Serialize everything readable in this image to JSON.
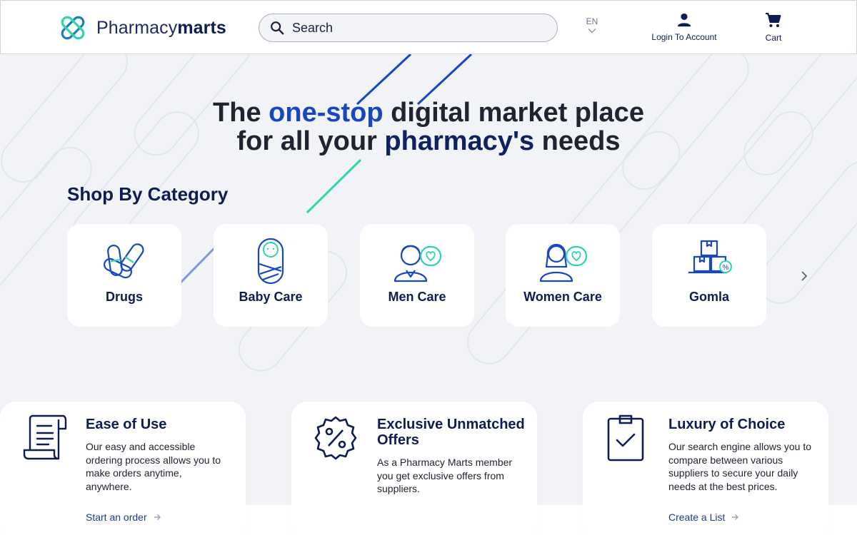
{
  "header": {
    "logo_text_light": "Pharmacy",
    "logo_text_bold": "marts",
    "search_placeholder": "Search",
    "language": "EN",
    "login_label": "Login To Account",
    "cart_label": "Cart"
  },
  "hero": {
    "line1_a": "The ",
    "line1_hl": "one-stop",
    "line1_b": " digital market place",
    "line2_a": "for all your ",
    "line2_hl": "pharmacy's",
    "line2_b": " needs"
  },
  "categories": {
    "title": "Shop By Category",
    "items": [
      {
        "label": "Drugs",
        "icon": "pills-icon"
      },
      {
        "label": "Baby Care",
        "icon": "baby-icon"
      },
      {
        "label": "Men Care",
        "icon": "man-icon"
      },
      {
        "label": "Women Care",
        "icon": "woman-icon"
      },
      {
        "label": "Gomla",
        "icon": "boxes-icon"
      }
    ]
  },
  "features": [
    {
      "title": "Ease of Use",
      "text": "Our easy and accessible ordering process allows you to make orders anytime, anywhere.",
      "link": "Start an order",
      "icon": "scroll-icon"
    },
    {
      "title": "Exclusive Unmatched Offers",
      "text": "As a Pharmacy Marts member you get exclusive offers from suppliers.",
      "link": "",
      "icon": "percent-badge-icon"
    },
    {
      "title": "Luxury of Choice",
      "text": "Our search engine allows you to compare between various suppliers to secure your daily needs at the best prices.",
      "link": "Create a List",
      "icon": "clipboard-check-icon"
    }
  ],
  "colors": {
    "navy": "#0d1d52",
    "brand_blue": "#1646c2",
    "teal": "#2ed3b0",
    "background": "#f2f3f7"
  }
}
